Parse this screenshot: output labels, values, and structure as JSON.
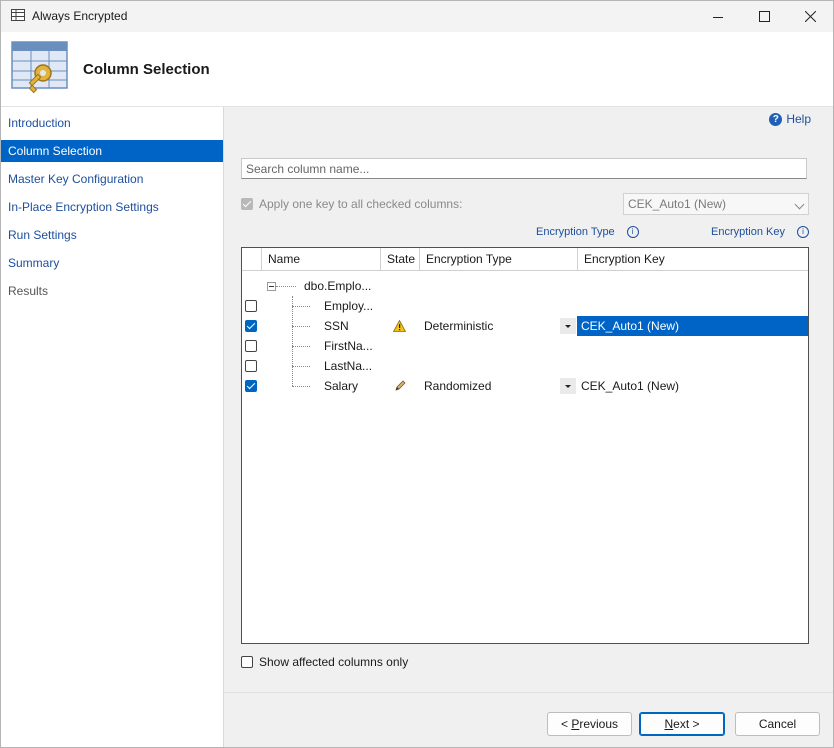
{
  "window": {
    "title": "Always Encrypted",
    "controls": [
      "minimize-icon",
      "maximize-icon",
      "close-icon"
    ]
  },
  "header": {
    "title": "Column Selection",
    "icon": "table-key-icon"
  },
  "sidebar": {
    "items": [
      {
        "label": "Introduction",
        "state": "link"
      },
      {
        "label": "Column Selection",
        "state": "active"
      },
      {
        "label": "Master Key Configuration",
        "state": "link"
      },
      {
        "label": "In-Place Encryption Settings",
        "state": "link"
      },
      {
        "label": "Run Settings",
        "state": "link"
      },
      {
        "label": "Summary",
        "state": "link"
      },
      {
        "label": "Results",
        "state": "disabled"
      }
    ]
  },
  "main": {
    "help_label": "Help",
    "search": {
      "placeholder": "Search column name...",
      "value": ""
    },
    "apply_key": {
      "label": "Apply one key to all checked columns:",
      "checked": true,
      "enabled": false
    },
    "key_select": {
      "value": "CEK_Auto1 (New)",
      "enabled": false
    },
    "legend": {
      "encryption_type": "Encryption Type",
      "encryption_key": "Encryption Key"
    },
    "grid": {
      "columns": [
        "Name",
        "State",
        "Encryption Type",
        "Encryption Key"
      ],
      "table": {
        "name": "dbo.Emplo..."
      },
      "rows": [
        {
          "name": "Employ...",
          "checked": false,
          "state_icon": "",
          "encryption_type": "",
          "encryption_key": "",
          "selected": false
        },
        {
          "name": "SSN",
          "checked": true,
          "state_icon": "warning-icon",
          "encryption_type": "Deterministic",
          "encryption_key": "CEK_Auto1 (New)",
          "selected": true
        },
        {
          "name": "FirstNa...",
          "checked": false,
          "state_icon": "",
          "encryption_type": "",
          "encryption_key": "",
          "selected": false
        },
        {
          "name": "LastNa...",
          "checked": false,
          "state_icon": "",
          "encryption_type": "",
          "encryption_key": "",
          "selected": false
        },
        {
          "name": "Salary",
          "checked": true,
          "state_icon": "pencil-icon",
          "encryption_type": "Randomized",
          "encryption_key": "CEK_Auto1 (New)",
          "selected": false
        }
      ]
    },
    "show_affected": {
      "label": "Show affected columns only",
      "checked": false
    }
  },
  "buttons": {
    "previous": {
      "prefix": "< ",
      "mnemonic": "P",
      "rest": "revious"
    },
    "next": {
      "mnemonic": "N",
      "rest": "ext",
      "suffix": " >"
    },
    "cancel": "Cancel"
  },
  "colors": {
    "accent": "#0063c6",
    "link": "#1d4f9c",
    "panel_bg": "#f0f0f0"
  }
}
